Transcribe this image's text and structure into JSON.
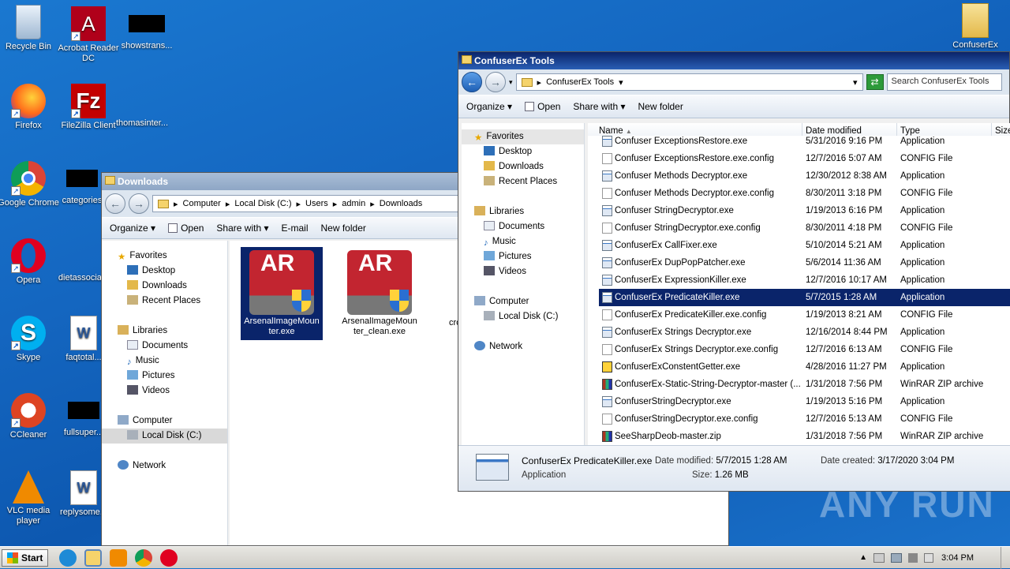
{
  "desktop": {
    "icons": [
      {
        "label": "Recycle Bin"
      },
      {
        "label": "Acrobat Reader DC"
      },
      {
        "label": "showstrans..."
      },
      {
        "label": "Firefox"
      },
      {
        "label": "FileZilla Client"
      },
      {
        "label": "thomasinter..."
      },
      {
        "label": "Google Chrome"
      },
      {
        "label": "categories"
      },
      {
        "label": "Opera"
      },
      {
        "label": "dietassocia..."
      },
      {
        "label": "Skype"
      },
      {
        "label": "faqtotal..."
      },
      {
        "label": "CCleaner"
      },
      {
        "label": "fullsuper..."
      },
      {
        "label": "VLC media player"
      },
      {
        "label": "replysome..."
      },
      {
        "label": "ConfuserEx"
      }
    ]
  },
  "downloads_window": {
    "title": "Downloads",
    "breadcrumb": [
      "Computer",
      "Local Disk (C:)",
      "Users",
      "admin",
      "Downloads"
    ],
    "toolbar": {
      "organize": "Organize",
      "open": "Open",
      "share_with": "Share with",
      "email": "E-mail",
      "new_folder": "New folder"
    },
    "nav": {
      "favorites": "Favorites",
      "desktop": "Desktop",
      "downloads": "Downloads",
      "recent": "Recent Places",
      "libraries": "Libraries",
      "documents": "Documents",
      "music": "Music",
      "pictures": "Pictures",
      "videos": "Videos",
      "computer": "Computer",
      "local_disk": "Local Disk (C:)",
      "network": "Network"
    },
    "files": [
      {
        "name": "ArsenalImageMounter.exe",
        "line1": "ArsenalImageMoun",
        "line2": "ter.exe"
      },
      {
        "name": "ArsenalImageMounter_clean.exe",
        "line1": "ArsenalImageMoun",
        "line2": "ter_clean.exe"
      },
      {
        "name": "cro",
        "line1": "cro",
        "line2": ""
      }
    ]
  },
  "tools_window": {
    "title": "ConfuserEx Tools",
    "breadcrumb": "ConfuserEx Tools",
    "search_placeholder": "Search ConfuserEx Tools",
    "toolbar": {
      "organize": "Organize",
      "open": "Open",
      "share_with": "Share with",
      "new_folder": "New folder"
    },
    "nav": {
      "favorites": "Favorites",
      "desktop": "Desktop",
      "downloads": "Downloads",
      "recent": "Recent Places",
      "libraries": "Libraries",
      "documents": "Documents",
      "music": "Music",
      "pictures": "Pictures",
      "videos": "Videos",
      "computer": "Computer",
      "local_disk": "Local Disk (C:)",
      "network": "Network"
    },
    "columns": {
      "name": "Name",
      "date": "Date modified",
      "type": "Type",
      "size": "Size"
    },
    "rows": [
      {
        "name": "Confuser ExceptionsRestore.exe",
        "date": "5/31/2016 9:16 PM",
        "type": "Application",
        "icon": "app"
      },
      {
        "name": "Confuser ExceptionsRestore.exe.config",
        "date": "12/7/2016 5:07 AM",
        "type": "CONFIG File",
        "icon": "cfg"
      },
      {
        "name": "Confuser Methods Decryptor.exe",
        "date": "12/30/2012 8:38 AM",
        "type": "Application",
        "icon": "app"
      },
      {
        "name": "Confuser Methods Decryptor.exe.config",
        "date": "8/30/2011 3:18 PM",
        "type": "CONFIG File",
        "icon": "cfg"
      },
      {
        "name": "Confuser StringDecryptor.exe",
        "date": "1/19/2013 6:16 PM",
        "type": "Application",
        "icon": "app"
      },
      {
        "name": "Confuser StringDecryptor.exe.config",
        "date": "8/30/2011 4:18 PM",
        "type": "CONFIG File",
        "icon": "cfg"
      },
      {
        "name": "ConfuserEx CallFixer.exe",
        "date": "5/10/2014 5:21 AM",
        "type": "Application",
        "icon": "app"
      },
      {
        "name": "ConfuserEx DupPopPatcher.exe",
        "date": "5/6/2014 11:36 AM",
        "type": "Application",
        "icon": "app"
      },
      {
        "name": "ConfuserEx ExpressionKiller.exe",
        "date": "12/7/2016 10:17 AM",
        "type": "Application",
        "icon": "app"
      },
      {
        "name": "ConfuserEx PredicateKiller.exe",
        "date": "5/7/2015 1:28 AM",
        "type": "Application",
        "icon": "app",
        "selected": true
      },
      {
        "name": "ConfuserEx PredicateKiller.exe.config",
        "date": "1/19/2013 8:21 AM",
        "type": "CONFIG File",
        "icon": "cfg"
      },
      {
        "name": "ConfuserEx Strings Decryptor.exe",
        "date": "12/16/2014 8:44 PM",
        "type": "Application",
        "icon": "app"
      },
      {
        "name": "ConfuserEx Strings Decryptor.exe.config",
        "date": "12/7/2016 6:13 AM",
        "type": "CONFIG File",
        "icon": "cfg"
      },
      {
        "name": "ConfuserExConstentGetter.exe",
        "date": "4/28/2016 11:27 PM",
        "type": "Application",
        "icon": "ghost"
      },
      {
        "name": "ConfuserEx-Static-String-Decryptor-master (...",
        "date": "1/31/2018 7:56 PM",
        "type": "WinRAR ZIP archive",
        "icon": "zip"
      },
      {
        "name": "ConfuserStringDecryptor.exe",
        "date": "1/19/2013 5:16 PM",
        "type": "Application",
        "icon": "app"
      },
      {
        "name": "ConfuserStringDecryptor.exe.config",
        "date": "12/7/2016 5:13 AM",
        "type": "CONFIG File",
        "icon": "cfg"
      },
      {
        "name": "SeeSharpDeob-master.zip",
        "date": "1/31/2018 7:56 PM",
        "type": "WinRAR ZIP archive",
        "icon": "zip"
      }
    ],
    "details": {
      "filename": "ConfuserEx PredicateKiller.exe",
      "type": "Application",
      "date_modified_label": "Date modified:",
      "date_modified": "5/7/2015 1:28 AM",
      "date_created_label": "Date created:",
      "date_created": "3/17/2020 3:04 PM",
      "size_label": "Size:",
      "size": "1.26 MB"
    }
  },
  "taskbar": {
    "start": "Start",
    "clock": "3:04 PM"
  },
  "watermark": "ANY RUN"
}
